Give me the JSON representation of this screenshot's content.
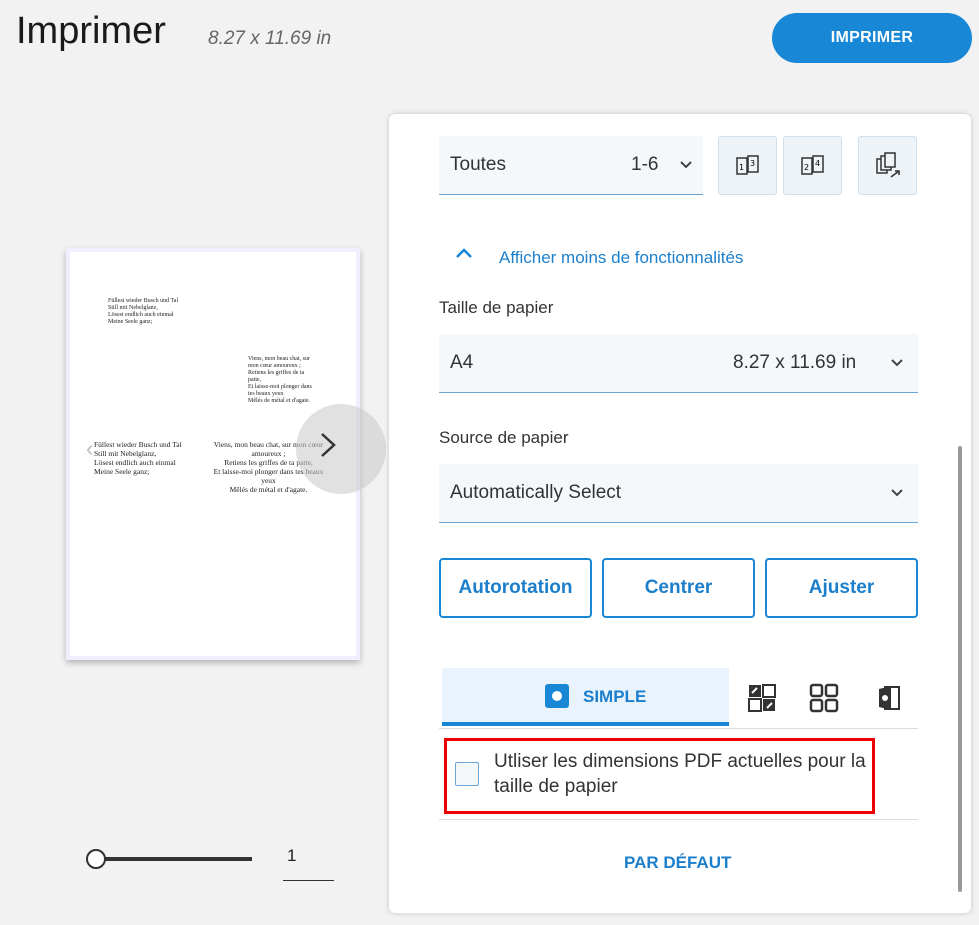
{
  "header": {
    "title": "Imprimer",
    "dimensions": "8.27 x 11.69 in",
    "print_button": "IMPRIMER"
  },
  "preview": {
    "snippet_a": "Füllest wieder Busch und Tal\nStill mit Nebelglanz,\nLösest endlich auch einmal\nMeine Seele ganz;",
    "snippet_b": "Viens, mon beau chat, sur\nmon cœur amoureux ;\nRetiens les griffes de ta\npatte,\nEt laisse-moi plonger dans\ntes beaux yeux\nMêlés de métal et d'agate.",
    "snippet_c": "Füllest wieder Busch und Tal\nStill mit Nebelglanz,\nLösest endlich auch einmal\nMeine Seele ganz;",
    "snippet_d": "Viens, mon beau chat, sur mon cœur amoureux ;\nRetiens les griffes de ta patte,\nEt laisse-moi plonger dans tes beaux yeux\nMêlés de métal et d'agate.",
    "page_number": "1"
  },
  "panel": {
    "pages_select": {
      "label": "Toutes",
      "value": "1-6"
    },
    "toggle_text": "Afficher moins de fonctionnalités",
    "paper_size": {
      "section": "Taille de papier",
      "label": "A4",
      "value": "8.27 x 11.69 in"
    },
    "paper_source": {
      "section": "Source de papier",
      "label": "Automatically Select"
    },
    "buttons": {
      "autorotate": "Autorotation",
      "center": "Centrer",
      "fit": "Ajuster"
    },
    "tabs": {
      "simple": "SIMPLE"
    },
    "checkbox_label": "Utliser les dimensions PDF actuelles pour la taille de papier",
    "default_button": "PAR DÉFAUT"
  },
  "colors": {
    "accent": "#1787d6",
    "highlight": "#e00000"
  }
}
